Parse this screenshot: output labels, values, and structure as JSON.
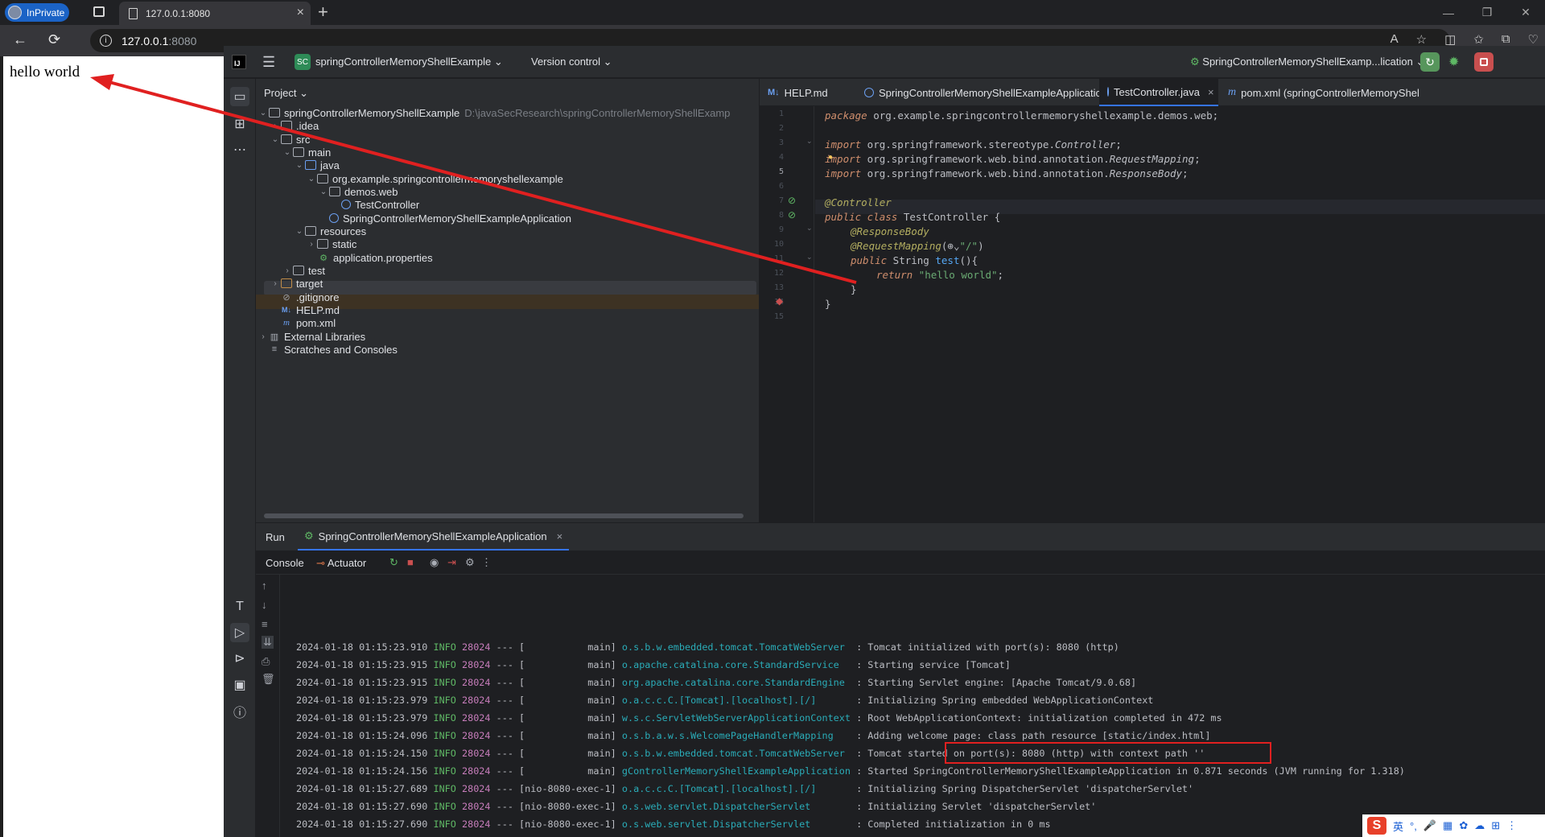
{
  "browser": {
    "private_label": "InPrivate",
    "tab_title": "127.0.0.1:8080",
    "url_host": "127.0.0.1",
    "url_port": ":8080"
  },
  "webpage": {
    "text": "hello world"
  },
  "ide": {
    "project_badge": "SC",
    "project_name": "springControllerMemoryShellExample",
    "vcs_label": "Version control",
    "run_config": "SpringControllerMemoryShellExamp...lication",
    "project_panel_title": "Project",
    "tree": [
      {
        "label": "springControllerMemoryShellExample",
        "hint": "D:\\javaSecResearch\\springControllerMemoryShellExamp"
      },
      {
        "label": ".idea"
      },
      {
        "label": "src"
      },
      {
        "label": "main"
      },
      {
        "label": "java"
      },
      {
        "label": "org.example.springcontrollermemoryshellexample"
      },
      {
        "label": "demos.web"
      },
      {
        "label": "TestController"
      },
      {
        "label": "SpringControllerMemoryShellExampleApplication"
      },
      {
        "label": "resources"
      },
      {
        "label": "static"
      },
      {
        "label": "application.properties"
      },
      {
        "label": "test"
      },
      {
        "label": "target"
      },
      {
        "label": ".gitignore"
      },
      {
        "label": "HELP.md"
      },
      {
        "label": "pom.xml"
      },
      {
        "label": "External Libraries"
      },
      {
        "label": "Scratches and Consoles"
      }
    ],
    "editor_tabs": [
      {
        "label": "HELP.md"
      },
      {
        "label": "SpringControllerMemoryShellExampleApplication.java"
      },
      {
        "label": "TestController.java"
      },
      {
        "label": "pom.xml (springControllerMemoryShel"
      }
    ],
    "code": {
      "l1_kw": "package",
      "l1_rest": " org.example.springcontrollermemoryshellexample.demos.web;",
      "l3_kw": "import",
      "l3_rest": " org.springframework.stereotype.",
      "l3_cls": "Controller",
      "l4_kw": "import",
      "l4_rest": " org.springframework.web.bind.annotation.",
      "l4_cls": "RequestMapping",
      "l5_kw": "import",
      "l5_rest": " org.springframework.web.bind.annotation.",
      "l5_cls": "ResponseBody",
      "l7": "@Controller",
      "l8_kw": "public class",
      "l8_rest": " TestController {",
      "l9": "@ResponseBody",
      "l10_an": "@RequestMapping",
      "l10_rest": "(",
      "l10_str": "\"/\"",
      "l10_close": ")",
      "l11_kw": "public",
      "l11_type": " String ",
      "l11_fn": "test",
      "l11_rest": "(){",
      "l12_kw": "return",
      "l12_str": " \"hello world\"",
      "l12_rest": ";",
      "l13": "}",
      "l14": "}"
    },
    "run": {
      "title": "Run",
      "app_tab": "SpringControllerMemoryShellExampleApplication",
      "console_tab": "Console",
      "actuator_tab": "Actuator",
      "logs": [
        {
          "ts": "2024-01-18 01:15:23.910",
          "lvl": "INFO",
          "pid": "28024",
          "sep": " --- [",
          "thread": "           main]",
          "cat": "o.s.b.w.embedded.tomcat.TomcatWebServer ",
          "msg": " : Tomcat initialized with port(s): 8080 (http)"
        },
        {
          "ts": "2024-01-18 01:15:23.915",
          "lvl": "INFO",
          "pid": "28024",
          "sep": " --- [",
          "thread": "           main]",
          "cat": "o.apache.catalina.core.StandardService  ",
          "msg": " : Starting service [Tomcat]"
        },
        {
          "ts": "2024-01-18 01:15:23.915",
          "lvl": "INFO",
          "pid": "28024",
          "sep": " --- [",
          "thread": "           main]",
          "cat": "org.apache.catalina.core.StandardEngine ",
          "msg": " : Starting Servlet engine: [Apache Tomcat/9.0.68]"
        },
        {
          "ts": "2024-01-18 01:15:23.979",
          "lvl": "INFO",
          "pid": "28024",
          "sep": " --- [",
          "thread": "           main]",
          "cat": "o.a.c.c.C.[Tomcat].[localhost].[/]      ",
          "msg": " : Initializing Spring embedded WebApplicationContext"
        },
        {
          "ts": "2024-01-18 01:15:23.979",
          "lvl": "INFO",
          "pid": "28024",
          "sep": " --- [",
          "thread": "           main]",
          "cat": "w.s.c.ServletWebServerApplicationContext",
          "msg": " : Root WebApplicationContext: initialization completed in 472 ms"
        },
        {
          "ts": "2024-01-18 01:15:24.096",
          "lvl": "INFO",
          "pid": "28024",
          "sep": " --- [",
          "thread": "           main]",
          "cat": "o.s.b.a.w.s.WelcomePageHandlerMapping   ",
          "msg": " : Adding welcome page: class path resource [static/index.html]"
        },
        {
          "ts": "2024-01-18 01:15:24.150",
          "lvl": "INFO",
          "pid": "28024",
          "sep": " --- [",
          "thread": "           main]",
          "cat": "o.s.b.w.embedded.tomcat.TomcatWebServer ",
          "msg": " : Tomcat started on port(s): 8080 (http) with context path ''"
        },
        {
          "ts": "2024-01-18 01:15:24.156",
          "lvl": "INFO",
          "pid": "28024",
          "sep": " --- [",
          "thread": "           main]",
          "cat": "gControllerMemoryShellExampleApplication",
          "msg": " : Started SpringControllerMemoryShellExampleApplication in 0.871 seconds (JVM running for 1.318)"
        },
        {
          "ts": "2024-01-18 01:15:27.689",
          "lvl": "INFO",
          "pid": "28024",
          "sep": " --- [",
          "thread": "nio-8080-exec-1]",
          "cat": "o.a.c.c.C.[Tomcat].[localhost].[/]      ",
          "msg": " : Initializing Spring DispatcherServlet 'dispatcherServlet'"
        },
        {
          "ts": "2024-01-18 01:15:27.690",
          "lvl": "INFO",
          "pid": "28024",
          "sep": " --- [",
          "thread": "nio-8080-exec-1]",
          "cat": "o.s.web.servlet.DispatcherServlet       ",
          "msg": " : Initializing Servlet 'dispatcherServlet'"
        },
        {
          "ts": "2024-01-18 01:15:27.690",
          "lvl": "INFO",
          "pid": "28024",
          "sep": " --- [",
          "thread": "nio-8080-exec-1]",
          "cat": "o.s.web.servlet.DispatcherServlet       ",
          "msg": " : Completed initialization in 0 ms"
        }
      ]
    }
  },
  "ime": {
    "label": "英"
  },
  "colors": {
    "accent": "#3574f0",
    "annotation_red": "#e02020",
    "run_green": "#57965c"
  }
}
